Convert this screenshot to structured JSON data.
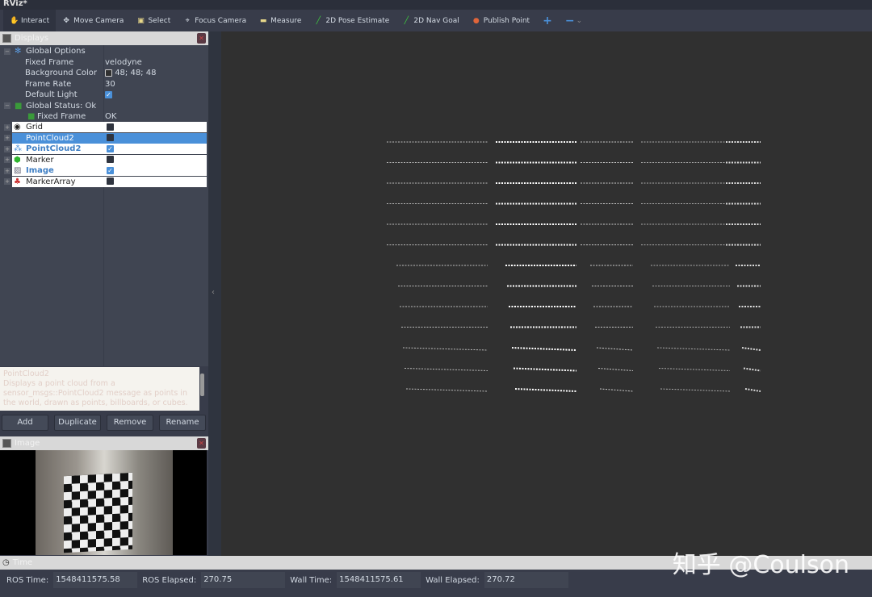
{
  "window": {
    "title": "RViz*"
  },
  "toolbar": [
    {
      "label": "Interact",
      "icon": "hand-icon",
      "glyph": "✋"
    },
    {
      "label": "Move Camera",
      "icon": "move-icon",
      "glyph": "✥"
    },
    {
      "label": "Select",
      "icon": "select-icon",
      "glyph": "▣"
    },
    {
      "label": "Focus Camera",
      "icon": "focus-icon",
      "glyph": "⌖"
    },
    {
      "label": "Measure",
      "icon": "ruler-icon",
      "glyph": "▬"
    },
    {
      "label": "2D Pose Estimate",
      "icon": "pose-arrow-icon",
      "glyph": "╱"
    },
    {
      "label": "2D Nav Goal",
      "icon": "nav-arrow-icon",
      "glyph": "╱"
    },
    {
      "label": "Publish Point",
      "icon": "pin-icon",
      "glyph": "●"
    }
  ],
  "toolbar_extra": {
    "add": "+",
    "remove": "−",
    "menu": "⌄"
  },
  "displays": {
    "title": "Displays",
    "global_options": "Global Options",
    "props": [
      {
        "name": "Fixed Frame",
        "value": "velodyne"
      },
      {
        "name": "Background Color",
        "value": "48; 48; 48"
      },
      {
        "name": "Frame Rate",
        "value": "30"
      },
      {
        "name": "Default Light",
        "value": ""
      }
    ],
    "global_status": "Global Status: Ok",
    "status_item": {
      "name": "Fixed Frame",
      "value": "OK"
    },
    "items": [
      {
        "label": "Grid",
        "checked": false
      },
      {
        "label": "PointCloud2",
        "checked": false
      },
      {
        "label": "PointCloud2",
        "checked": true
      },
      {
        "label": "Marker",
        "checked": false
      },
      {
        "label": "Image",
        "checked": true
      },
      {
        "label": "MarkerArray",
        "checked": false
      }
    ],
    "description": {
      "title": "PointCloud2",
      "text": "Displays a point cloud from a sensor_msgs::PointCloud2 message as points in the world, drawn as points, billboards, or cubes."
    },
    "buttons": {
      "add": "Add",
      "duplicate": "Duplicate",
      "remove": "Remove",
      "rename": "Rename"
    }
  },
  "image_panel": {
    "title": "Image"
  },
  "time": {
    "title": "Time",
    "ros_time_label": "ROS Time:",
    "ros_time": "1548411575.58",
    "ros_elapsed_label": "ROS Elapsed:",
    "ros_elapsed": "270.75",
    "wall_time_label": "Wall Time:",
    "wall_time": "1548411575.61",
    "wall_elapsed_label": "Wall Elapsed:",
    "wall_elapsed": "270.72"
  },
  "watermark": "知乎 @Coulson"
}
